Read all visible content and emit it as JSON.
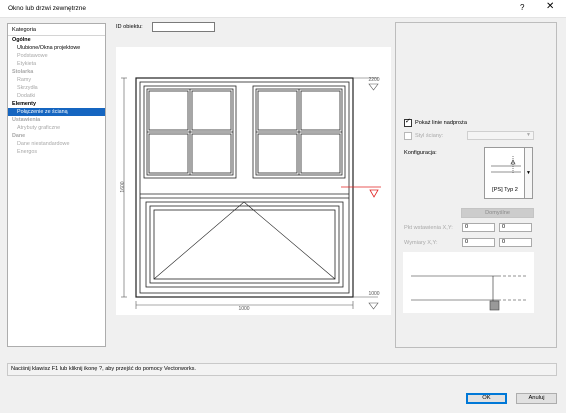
{
  "window": {
    "title": "Okno lub drzwi zewnętrzne",
    "help": "?",
    "close": "✕"
  },
  "sidebar": {
    "header": "Kategoria",
    "items": [
      {
        "label": "Ogólne",
        "level": 0,
        "state": "normal"
      },
      {
        "label": "Ulubione/Okna projektowe",
        "level": 1,
        "state": "normal"
      },
      {
        "label": "Podstawowe",
        "level": 1,
        "state": "disabled"
      },
      {
        "label": "Etykieta",
        "level": 1,
        "state": "disabled"
      },
      {
        "label": "Stolarka",
        "level": 0,
        "state": "disabled"
      },
      {
        "label": "Ramy",
        "level": 1,
        "state": "disabled"
      },
      {
        "label": "Skrzydła",
        "level": 1,
        "state": "disabled"
      },
      {
        "label": "Dodatki",
        "level": 1,
        "state": "disabled"
      },
      {
        "label": "Elementy",
        "level": 0,
        "state": "normal"
      },
      {
        "label": "Połączenie ze ścianą",
        "level": 1,
        "state": "selected"
      },
      {
        "label": "Ustawienia",
        "level": 0,
        "state": "disabled"
      },
      {
        "label": "Atrybuty graficzne",
        "level": 1,
        "state": "disabled"
      },
      {
        "label": "Dane",
        "level": 0,
        "state": "disabled"
      },
      {
        "label": "Dane niestandardowe",
        "level": 1,
        "state": "disabled"
      },
      {
        "label": "Energos",
        "level": 1,
        "state": "disabled"
      }
    ]
  },
  "object_id": {
    "label": "ID obiektu:",
    "value": ""
  },
  "preview": {
    "dim_width": "1000",
    "dim_height": "1600",
    "dim_top": "2200",
    "dim_bottom": "1000"
  },
  "options": {
    "show_lintel_label": "Pokaż linie nadproża",
    "show_lintel_checked": true,
    "wall_style_label": "Styl ściany:",
    "wall_style_value": "",
    "config_label": "Konfiguracja:",
    "config_value": "[PS] Typ 2",
    "defaults_button": "Domyślne",
    "offset_label": "Pkt wstawienia X,Y:",
    "offset_x": "0",
    "offset_y": "0",
    "size_label": "Wymiary X,Y:",
    "size_x": "0",
    "size_y": "0"
  },
  "status": "Naciśnij klawisz F1 lub kliknij ikonę ?, aby przejść do pomocy Vectorworks.",
  "buttons": {
    "ok": "OK",
    "cancel": "Anuluj"
  }
}
